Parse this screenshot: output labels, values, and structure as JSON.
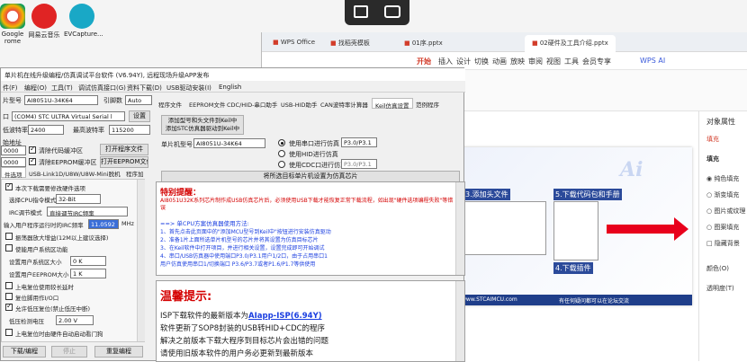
{
  "desktop": {
    "icons": [
      {
        "label": "Google",
        "label2": "rome",
        "color": "#e84c3d"
      },
      {
        "label": "网易云音乐",
        "label2": "",
        "color": "#e02424"
      },
      {
        "label": "EVCapture...",
        "label2": "",
        "color": "#19a8c6"
      }
    ]
  },
  "ppt": {
    "tabs": [
      "WPS Office",
      "找稻壳模板",
      "01序.pptx",
      "02硬件及工具介绍.pptx"
    ],
    "ribbon": [
      "开始",
      "插入",
      "设计",
      "切换",
      "动画",
      "放映",
      "审阅",
      "视图",
      "工具",
      "会员专享"
    ],
    "ai_label": "WPS AI",
    "slide_texts": [
      "3.添加头文件",
      "5.下载代码包和手册",
      "4.下载插件",
      "www.STCAIMCU.com",
      "有任何疑问都可以在论坛交流"
    ],
    "slide_logo": "Ai",
    "right_panel": {
      "title": "对象属性",
      "section": "填充",
      "sub": "填充",
      "options": [
        "纯色填充",
        "渐变填充",
        "图片或纹理",
        "图案填充",
        "隐藏背景"
      ],
      "color_label": "颜色(O)",
      "transparency_label": "透明度(T)"
    },
    "accent": "#d23c2a"
  },
  "app": {
    "title": "单片机在线升级编程/仿真调试平台软件 (V6.94Y), 远程现场升级APP发布",
    "menu": [
      "件(F)",
      "编程(O)",
      "工具(T)",
      "调试仿真接口(G)",
      "资料下载(D)",
      "USB驱动安装(I)",
      "English"
    ],
    "chip_label": "片型号",
    "chip_value": "AI8051U-34K64",
    "freq_label": "引脚数",
    "freq_value": "Auto",
    "port_label": "口",
    "port_value": "(COM4) STC ULTRA Virtual Serial l",
    "port_btn": "设置",
    "baud_label": "低波特率",
    "baud_value": "2400",
    "maxbaud_label": "最高波特率",
    "maxbaud_value": "115200",
    "addr_label": "始地址",
    "addr1": "0000",
    "addr2": "0000",
    "clear1": "清除代码缓冲区",
    "clear2": "清除EEPROM缓冲区",
    "open_prog": "打开程序文件",
    "open_eeprom": "打开EEPROM文件",
    "left_tabs": [
      "件选项",
      "USB-Link1D/U8W/U8W-Mini脱机",
      "程序加"
    ],
    "left_rows": [
      "本次下载需要修改硬件选项",
      "选择CPU指令模式  32-Bit",
      "IRC调节模式  直接调节IRC频率",
      "输入用户程序运行时的IRC频率  11.0592  MHz",
      "振荡器放大增益(12M以上建议选择)",
      "使能用户系统区功能",
      "设置用户系统区大小  0 K",
      "设置用户EEPROM大小  1 K",
      "上电复位使用较长延时",
      "复位脚用作I/O口",
      "允许低压复位(禁止低压中断)",
      "低压检测电压  2.00 V",
      "上电复位时由硬件自动启动看门狗"
    ],
    "bottom_btns": [
      "下载/编程",
      "停止",
      "重复编程"
    ],
    "right_tabs": [
      "程序文件",
      "EEPROM文件",
      "CDC/HID-串口助手",
      "USB-HID助手",
      "CAN波特率计算器",
      "Keil仿真设置",
      "范例程序"
    ],
    "keil_btn": "添加型号和头文件到Keil中\n添加STC仿真器驱动到Keil中",
    "sim_chip_label": "单片机型号",
    "sim_chip_value": "AI8051U-34K64",
    "radios": [
      {
        "label": "使用串口进行仿真",
        "value": "P3.0/P3.1"
      },
      {
        "label": "使用HID进行仿真",
        "value": ""
      },
      {
        "label": "使用CDC口进行仿真",
        "value": "P3.0/P3.1"
      }
    ],
    "set_sim_btn": "将所选目标单片机设置为仿真芯片",
    "notice_title": "特别提醒：",
    "notice_red": "AI8051U32K系列芯片制作成USB仿真芯片后，必须使用USB下载才能恢复正常下载流程，如出现\"硬件选项编程失败\"等错误",
    "notice_head": "==> 单CPU方案仿真器使用方法:",
    "notice_lines": [
      "1、首先点击此页面中的\"添加MCU型号到Keil中\"按钮进行安装仿真驱动",
      "2、准备1片上面所选单片机型号的芯片并将其设置为仿真目标芯片",
      "3、在Keil软件中打开项目，并进行相关设置，设置完成即可开始调试",
      "4、串口/USB仿真器中使用端口P3.0/P3.1用户1/2口，由于占用串口1",
      "   用户仿真使用串口1/切换端口 P3.6/P3.7或者P1.6/P1.7等供使用"
    ],
    "tips_title": "温馨提示:",
    "tips_line1_pre": "ISP下载软件的最新版本为",
    "tips_line1_link": "AIapp-ISP(6.94Y)",
    "tips_lines": [
      "软件更新了SOP8封装的USB转HID+CDC的程序",
      "解决之前版本下载大程序到目标芯片会出错的问题",
      "请使用旧版本软件的用户务必更新到最新版本"
    ]
  }
}
